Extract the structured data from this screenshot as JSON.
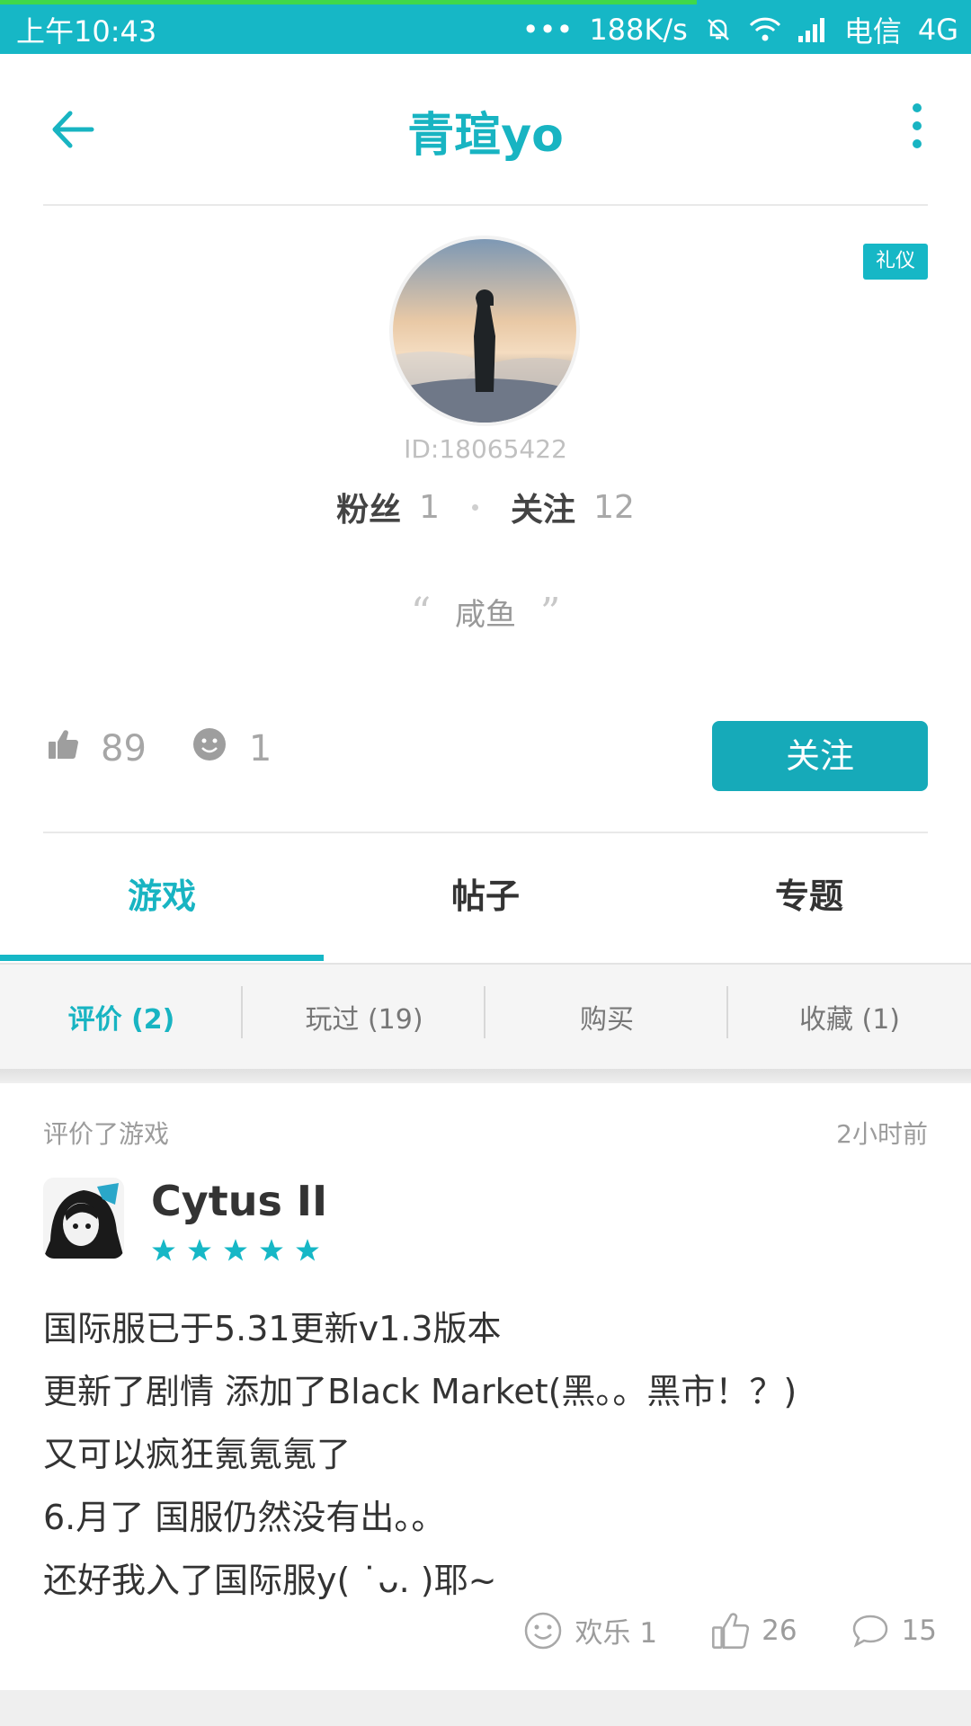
{
  "status_bar": {
    "time": "上午10:43",
    "dots": "•••",
    "speed": "188K/s",
    "carrier": "电信",
    "network": "4G"
  },
  "header": {
    "title": "青瑄yo"
  },
  "profile": {
    "badge": "礼仪",
    "user_id": "ID:18065422",
    "fans_label": "粉丝",
    "fans_count": "1",
    "following_label": "关注",
    "following_count": "12",
    "quote_open": "“",
    "signature": "咸鱼",
    "quote_close": "”",
    "likes": "89",
    "smiles": "1",
    "follow_button": "关注"
  },
  "tabs": [
    {
      "label": "游戏",
      "active": true
    },
    {
      "label": "帖子",
      "active": false
    },
    {
      "label": "专题",
      "active": false
    }
  ],
  "subtabs": [
    {
      "label": "评价 (2)",
      "active": true
    },
    {
      "label": "玩过 (19)",
      "active": false
    },
    {
      "label": "购买",
      "active": false
    },
    {
      "label": "收藏 (1)",
      "active": false
    }
  ],
  "review_card": {
    "action_text": "评价了游戏",
    "time_ago": "2小时前",
    "game_name": "Cytus II",
    "rating": 5,
    "lines": [
      "国际服已于5.31更新v1.3版本",
      "更新了剧情 添加了Black Market(黑。。黑市！？)",
      "又可以疯狂氪氪氪了",
      "6.月了 国服仍然没有出。。",
      "还好我入了国际服y( ˙ᴗ. )耶~"
    ],
    "fun_label": "欢乐 1",
    "likes": "26",
    "comments": "15"
  },
  "colors": {
    "accent": "#16b7c6",
    "button": "#16aab9",
    "star": "#16b7c6"
  }
}
